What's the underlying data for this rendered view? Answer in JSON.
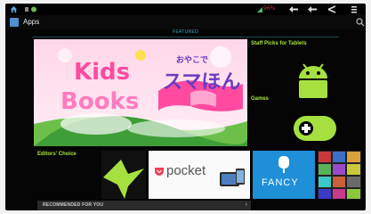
{
  "status_bar": {
    "icons": [
      "home-icon",
      "app-notification-icon",
      "signal-icon",
      "nav-back-icon",
      "nav-home-icon",
      "nav-recent-icon",
      "menu-icon"
    ],
    "signal_text": "96%"
  },
  "action_bar": {
    "title": "Apps",
    "icons": [
      "apps-icon",
      "search-icon"
    ]
  },
  "featured": {
    "label": "FEATURED"
  },
  "hero": {
    "title_line1": "Kids",
    "title_line2": "Books",
    "japanese_text": "スマほん",
    "japanese_small": "おやこで"
  },
  "sections": {
    "staff_picks": "Staff Picks for Tablets",
    "games": "Games",
    "editors_choice": "Editors' Choice"
  },
  "editors_tiles": {
    "pocket": "pocket",
    "fancy": "FANCY"
  },
  "recommended": {
    "label": "RECOMMENDED FOR YOU"
  },
  "colors": {
    "accent_green": "#a6e040",
    "featured_blue": "#3fa7be",
    "fancy_blue": "#1f8fd8",
    "pocket_red": "#ee4056"
  }
}
